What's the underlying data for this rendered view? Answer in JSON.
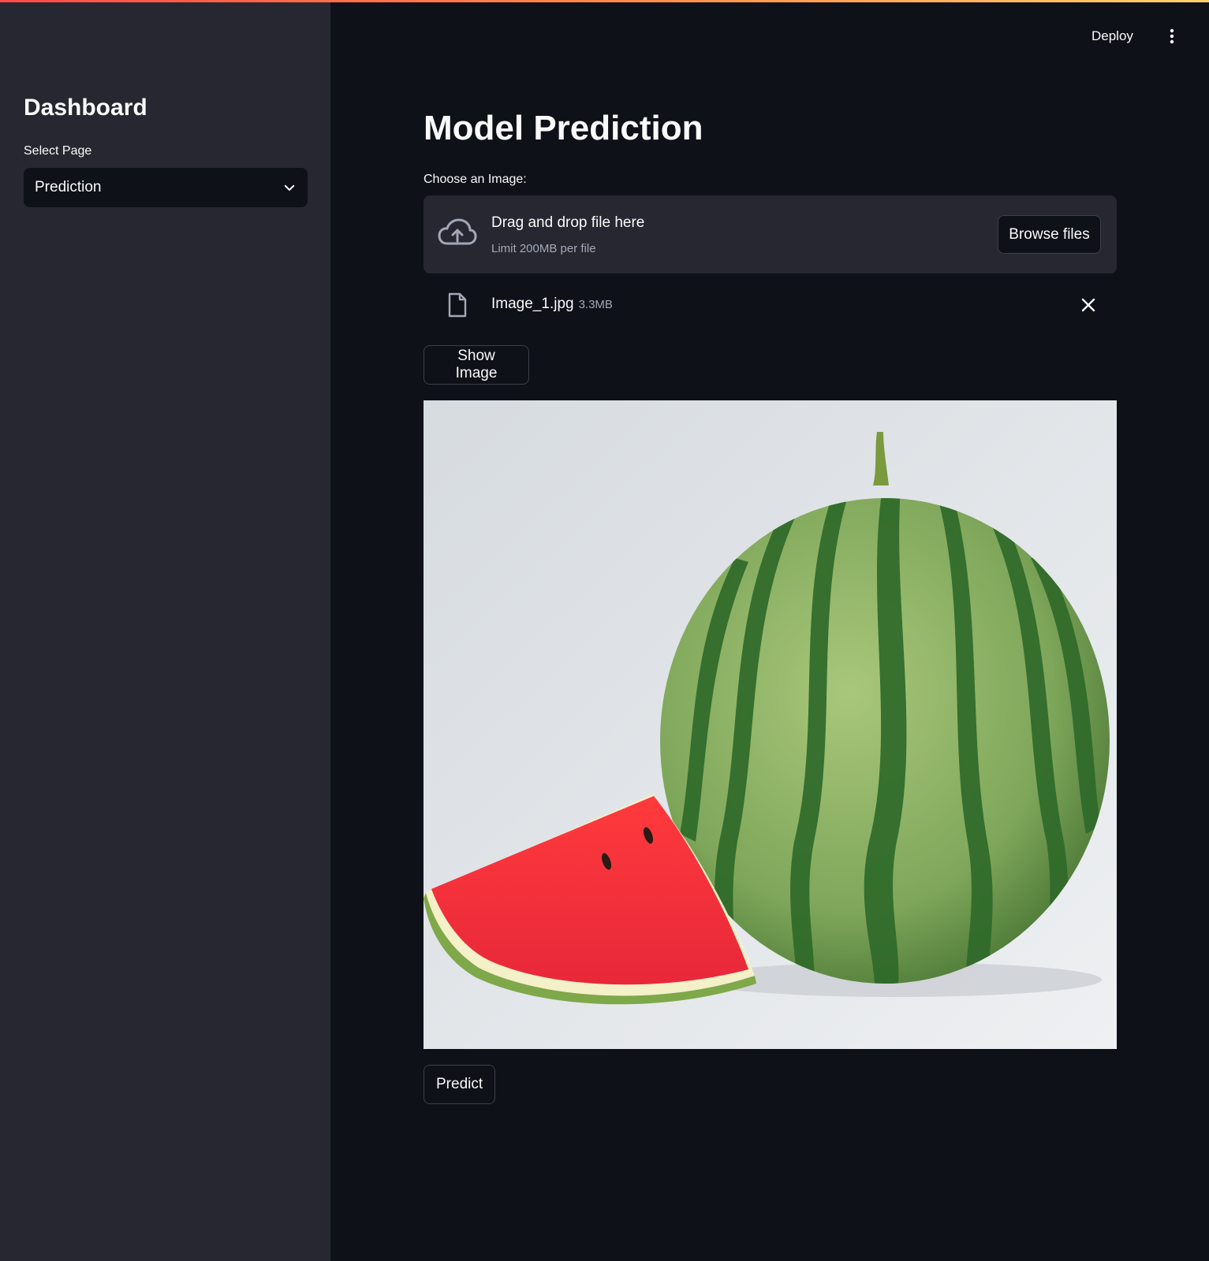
{
  "sidebar": {
    "title": "Dashboard",
    "select_label": "Select Page",
    "select_value": "Prediction"
  },
  "header": {
    "deploy_label": "Deploy"
  },
  "main": {
    "title": "Model Prediction",
    "uploader": {
      "label": "Choose an Image:",
      "drop_text": "Drag and drop file here",
      "limit_text": "Limit 200MB per file",
      "browse_label": "Browse files"
    },
    "file": {
      "name": "Image_1.jpg",
      "size": "3.3MB"
    },
    "show_image_label": "Show Image",
    "predict_label": "Predict"
  },
  "colors": {
    "background": "#0e1117",
    "sidebar": "#262730",
    "accent_gradient": [
      "#ff4b4b",
      "#ffd16a"
    ]
  },
  "icons": [
    "upload-cloud-icon",
    "file-icon",
    "close-icon",
    "chevron-down-icon",
    "kebab-menu-icon"
  ]
}
